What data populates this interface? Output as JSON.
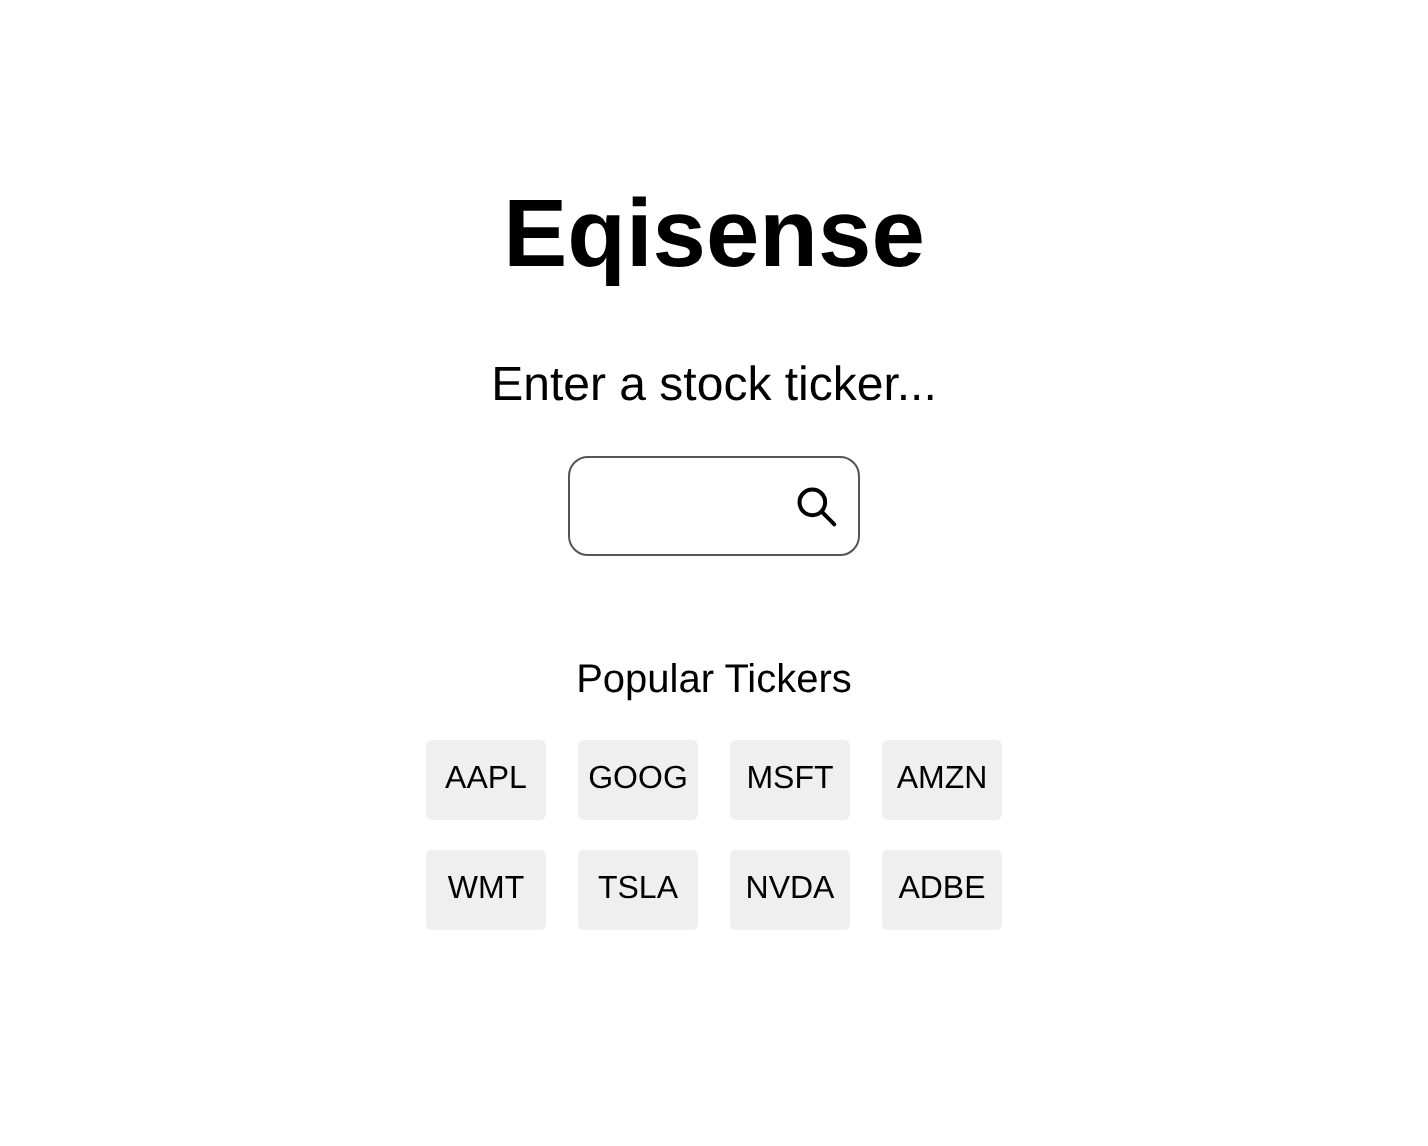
{
  "title": "Eqisense",
  "prompt": "Enter a stock ticker...",
  "popular": {
    "heading": "Popular Tickers",
    "tickers": [
      "AAPL",
      "GOOG",
      "MSFT",
      "AMZN",
      "WMT",
      "TSLA",
      "NVDA",
      "ADBE"
    ]
  }
}
